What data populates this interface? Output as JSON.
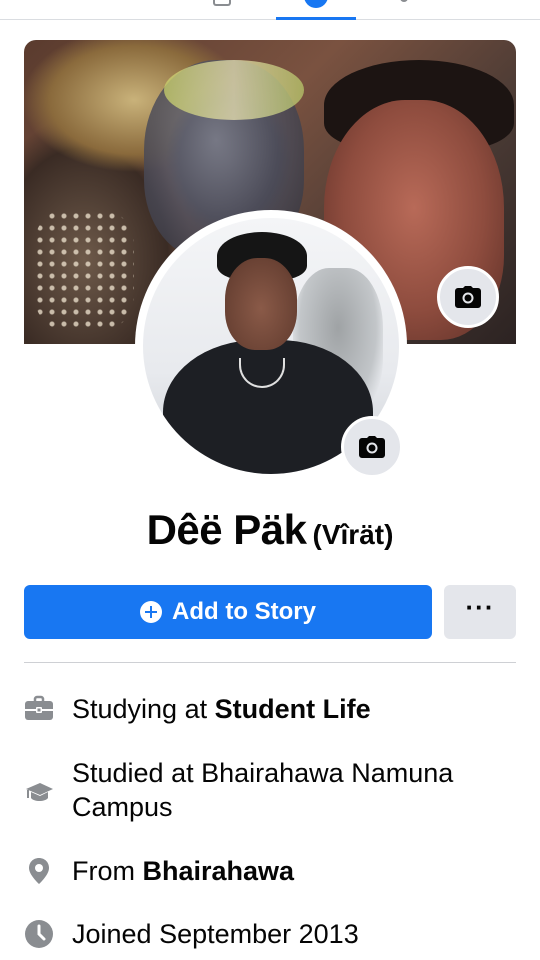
{
  "profile": {
    "name": "Dêë Päk",
    "nickname": "(Vîrät)"
  },
  "actions": {
    "add_story_label": "Add to Story",
    "more_label": "···"
  },
  "details": {
    "studying_prefix": "Studying at ",
    "studying_place": "Student Life",
    "studied_text": "Studied at Bhairahawa Namuna Campus",
    "from_prefix": "From ",
    "from_place": "Bhairahawa",
    "joined_text": "Joined September 2013"
  },
  "icons": {
    "cover_camera": "camera-icon",
    "avatar_camera": "camera-icon",
    "studying": "briefcase-icon",
    "studied": "graduation-cap-icon",
    "from": "location-pin-icon",
    "joined": "clock-icon"
  },
  "colors": {
    "accent": "#1877f2",
    "secondary_button": "#e4e6eb",
    "icon_gray": "#8a8d91"
  }
}
